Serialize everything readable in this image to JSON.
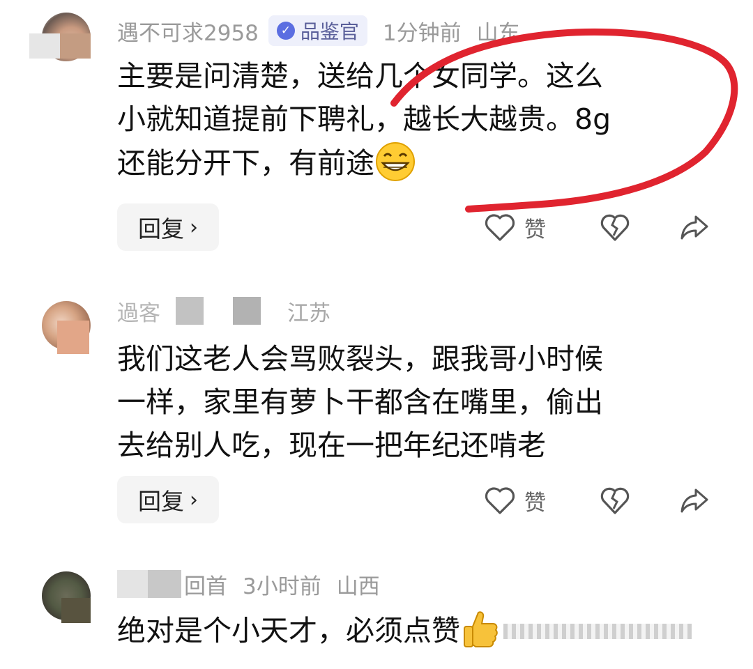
{
  "comments": [
    {
      "username": "遇不可求2958",
      "badge": "品鉴官",
      "time": "1分钟前",
      "location": "山东",
      "lines": [
        "主要是问清楚，送给几个女同学。这么",
        "小就知道提前下聘礼，越长大越贵。8g",
        "还能分开下，有前途"
      ],
      "reply_label": "回复",
      "like_label": "赞"
    },
    {
      "username": "過客",
      "time": "",
      "location": "江苏",
      "lines": [
        "我们这老人会骂败裂头，跟我哥小时候",
        "一样，家里有萝卜干都含在嘴里，偷出",
        "去给别人吃，现在一把年纪还啃老"
      ],
      "reply_label": "回复",
      "like_label": "赞"
    },
    {
      "username": "回首",
      "time": "3小时前",
      "location": "山西",
      "lines": [
        "绝对是个小天才，必须点赞"
      ]
    }
  ],
  "icons": {
    "badge": "verified-check-icon",
    "reply_chevron": "chevron-right-icon",
    "like": "heart-outline-icon",
    "dislike": "broken-heart-icon",
    "share": "share-arrow-icon",
    "emoji1": "grinning-face-emoji",
    "emoji2": "thumbs-up-emoji"
  },
  "colors": {
    "annotation_stroke": "#e0242f",
    "badge_bg": "#eef0fb",
    "badge_icon": "#5b6ee1",
    "meta_text": "#9a9a9a"
  }
}
